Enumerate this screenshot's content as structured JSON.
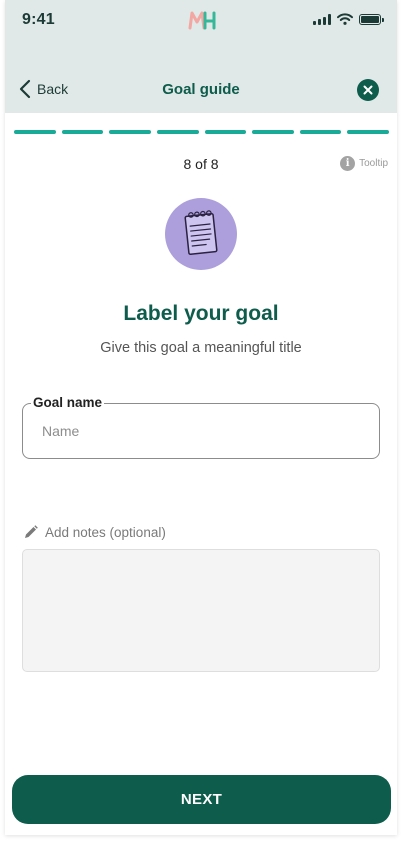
{
  "status_bar": {
    "time": "9:41"
  },
  "colors": {
    "brand": "#0d5c4c",
    "progress": "#1aaa98",
    "header_bg": "#e0e9e7",
    "illustration_bg": "#ac9fdc"
  },
  "nav": {
    "back_label": "Back",
    "title": "Goal guide",
    "close_icon": "close-icon"
  },
  "progress": {
    "total_segments": 8,
    "completed": 8,
    "label": "8 of 8"
  },
  "tooltip": {
    "label": "Tooltip",
    "icon": "info-icon"
  },
  "illustration": {
    "icon": "notepad-icon"
  },
  "content": {
    "heading": "Label your goal",
    "subheading": "Give this goal a meaningful title"
  },
  "goal_name": {
    "label": "Goal name",
    "placeholder": "Name",
    "value": ""
  },
  "notes": {
    "label": "Add notes (optional)",
    "icon": "pencil-icon",
    "value": ""
  },
  "footer": {
    "next_label": "NEXT"
  }
}
